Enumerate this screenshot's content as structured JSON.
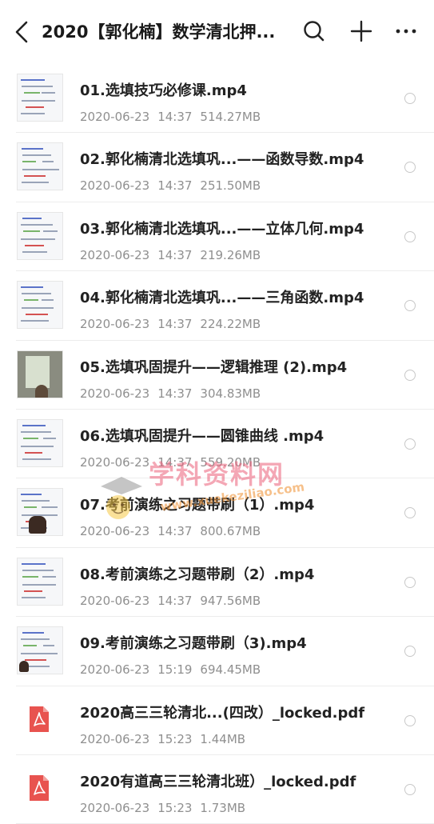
{
  "header": {
    "title": "2020【郭化楠】数学清北押..."
  },
  "files": [
    {
      "name": "01.选填技巧必修课.mp4",
      "date": "2020-06-23",
      "time": "14:37",
      "size": "514.27MB",
      "thumb": "math-notes"
    },
    {
      "name": "02.郭化楠清北选填巩...——函数导数.mp4",
      "date": "2020-06-23",
      "time": "14:37",
      "size": "251.50MB",
      "thumb": "math-notes"
    },
    {
      "name": "03.郭化楠清北选填巩...——立体几何.mp4",
      "date": "2020-06-23",
      "time": "14:37",
      "size": "219.26MB",
      "thumb": "math-notes"
    },
    {
      "name": "04.郭化楠清北选填巩...——三角函数.mp4",
      "date": "2020-06-23",
      "time": "14:37",
      "size": "224.22MB",
      "thumb": "math-notes"
    },
    {
      "name": "05.选填巩固提升——逻辑推理 (2).mp4",
      "date": "2020-06-23",
      "time": "14:37",
      "size": "304.83MB",
      "thumb": "classroom"
    },
    {
      "name": "06.选填巩固提升——圆锥曲线 .mp4",
      "date": "2020-06-23",
      "time": "14:37",
      "size": "559.20MB",
      "thumb": "math-notes"
    },
    {
      "name": "07.考前演练之习题带刷（1）.mp4",
      "date": "2020-06-23",
      "time": "14:37",
      "size": "800.67MB",
      "thumb": "teacher"
    },
    {
      "name": "08.考前演练之习题带刷（2）.mp4",
      "date": "2020-06-23",
      "time": "14:37",
      "size": "947.56MB",
      "thumb": "math-notes"
    },
    {
      "name": "09.考前演练之习题带刷（3).mp4",
      "date": "2020-06-23",
      "time": "15:19",
      "size": "694.45MB",
      "thumb": "teacher-small"
    },
    {
      "name": "2020高三三轮清北...(四改）_locked.pdf",
      "date": "2020-06-23",
      "time": "15:23",
      "size": "1.44MB",
      "thumb": "pdf"
    },
    {
      "name": "2020有道高三三轮清北班）_locked.pdf",
      "date": "2020-06-23",
      "time": "15:23",
      "size": "1.73MB",
      "thumb": "pdf"
    }
  ],
  "watermark": {
    "text": "学科资料网",
    "url": "www.xuekeziliao.com"
  },
  "colors": {
    "pdf_icon": "#e8534f",
    "meta_text": "#8f8f8f",
    "title_text": "#1a1a1a"
  }
}
